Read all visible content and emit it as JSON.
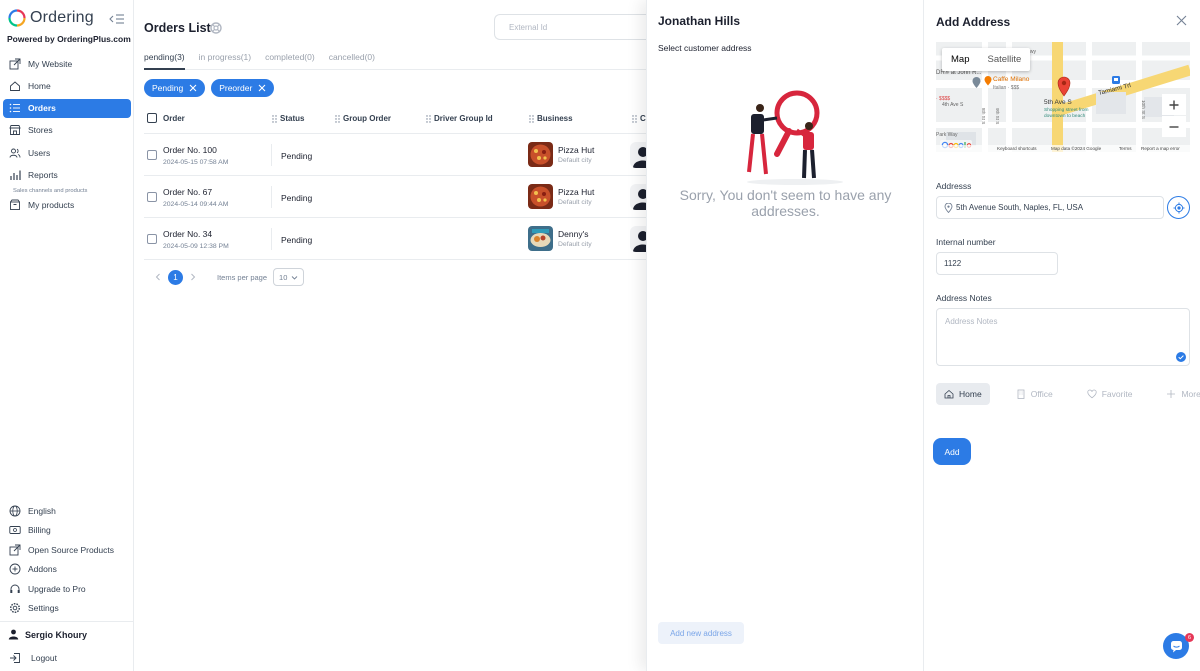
{
  "sidebar": {
    "logo_text": "Ordering",
    "powered_by": "Powered by OrderingPlus.com",
    "items": [
      {
        "label": "My Website"
      },
      {
        "label": "Home"
      },
      {
        "label": "Orders"
      },
      {
        "label": "Stores"
      },
      {
        "label": "Users"
      },
      {
        "label": "Reports"
      }
    ],
    "section_label": "Sales channels and products",
    "products_label": "My products",
    "bottom_items": [
      {
        "label": "English"
      },
      {
        "label": "Billing"
      },
      {
        "label": "Open Source Products"
      },
      {
        "label": "Addons"
      },
      {
        "label": "Upgrade to Pro"
      },
      {
        "label": "Settings"
      }
    ],
    "user_name": "Sergio Khoury",
    "logout_label": "Logout"
  },
  "orders": {
    "title": "Orders List",
    "external_id_placeholder": "External Id",
    "tabs": [
      {
        "label": "pending(3)"
      },
      {
        "label": "in progress(1)"
      },
      {
        "label": "completed(0)"
      },
      {
        "label": "cancelled(0)"
      }
    ],
    "chips": [
      {
        "label": "Pending"
      },
      {
        "label": "Preorder"
      }
    ],
    "columns": {
      "order": "Order",
      "status": "Status",
      "group_order": "Group Order",
      "driver_group": "Driver Group Id",
      "business": "Business",
      "customer": "C"
    },
    "rows": [
      {
        "number": "Order No. 100",
        "date": "2024-05-15 07:58 AM",
        "status": "Pending",
        "business": "Pizza Hut",
        "city": "Default city"
      },
      {
        "number": "Order No. 67",
        "date": "2024-05-14 09:44 AM",
        "status": "Pending",
        "business": "Pizza Hut",
        "city": "Default city"
      },
      {
        "number": "Order No. 34",
        "date": "2024-05-09 12:38 PM",
        "status": "Pending",
        "business": "Denny's",
        "city": "Default city"
      }
    ],
    "pager": {
      "current": "1",
      "items_per_page_label": "Items per page",
      "items_per_page": "10"
    }
  },
  "customer_panel": {
    "name": "Jonathan Hills",
    "subtitle": "Select customer address",
    "empty_message": "Sorry, You don't seem to have any addresses.",
    "add_new_label": "Add new address"
  },
  "add_address": {
    "title": "Add Address",
    "map": {
      "toggle_map": "Map",
      "toggle_satellite": "Satellite",
      "place_labels": [
        "Caffe Milano",
        "Italian · $$$",
        "5th Ave S",
        "Shopping street from downtown to beach",
        "Tamiami Trl",
        "DR® at John R...",
        "· $$$$",
        "Park Way",
        "Pkwy",
        "10th St S",
        "8th St S",
        "9th St S",
        "4th Ave S"
      ],
      "footer": [
        "Keyboard shortcuts",
        "Map data ©2024 Google",
        "Terms",
        "Report a map error"
      ]
    },
    "address_label": "Addresss",
    "address_value": "5th Avenue South, Naples, FL, USA",
    "internal_label": "Internal number",
    "internal_value": "1122",
    "notes_label": "Address Notes",
    "notes_placeholder": "Address Notes",
    "tags": [
      {
        "label": "Home"
      },
      {
        "label": "Office"
      },
      {
        "label": "Favorite"
      },
      {
        "label": "More"
      }
    ],
    "add_label": "Add"
  },
  "chat_badge": "6",
  "colors": {
    "primary": "#2c7be5",
    "text": "#344050",
    "muted": "#9aa1ac"
  }
}
